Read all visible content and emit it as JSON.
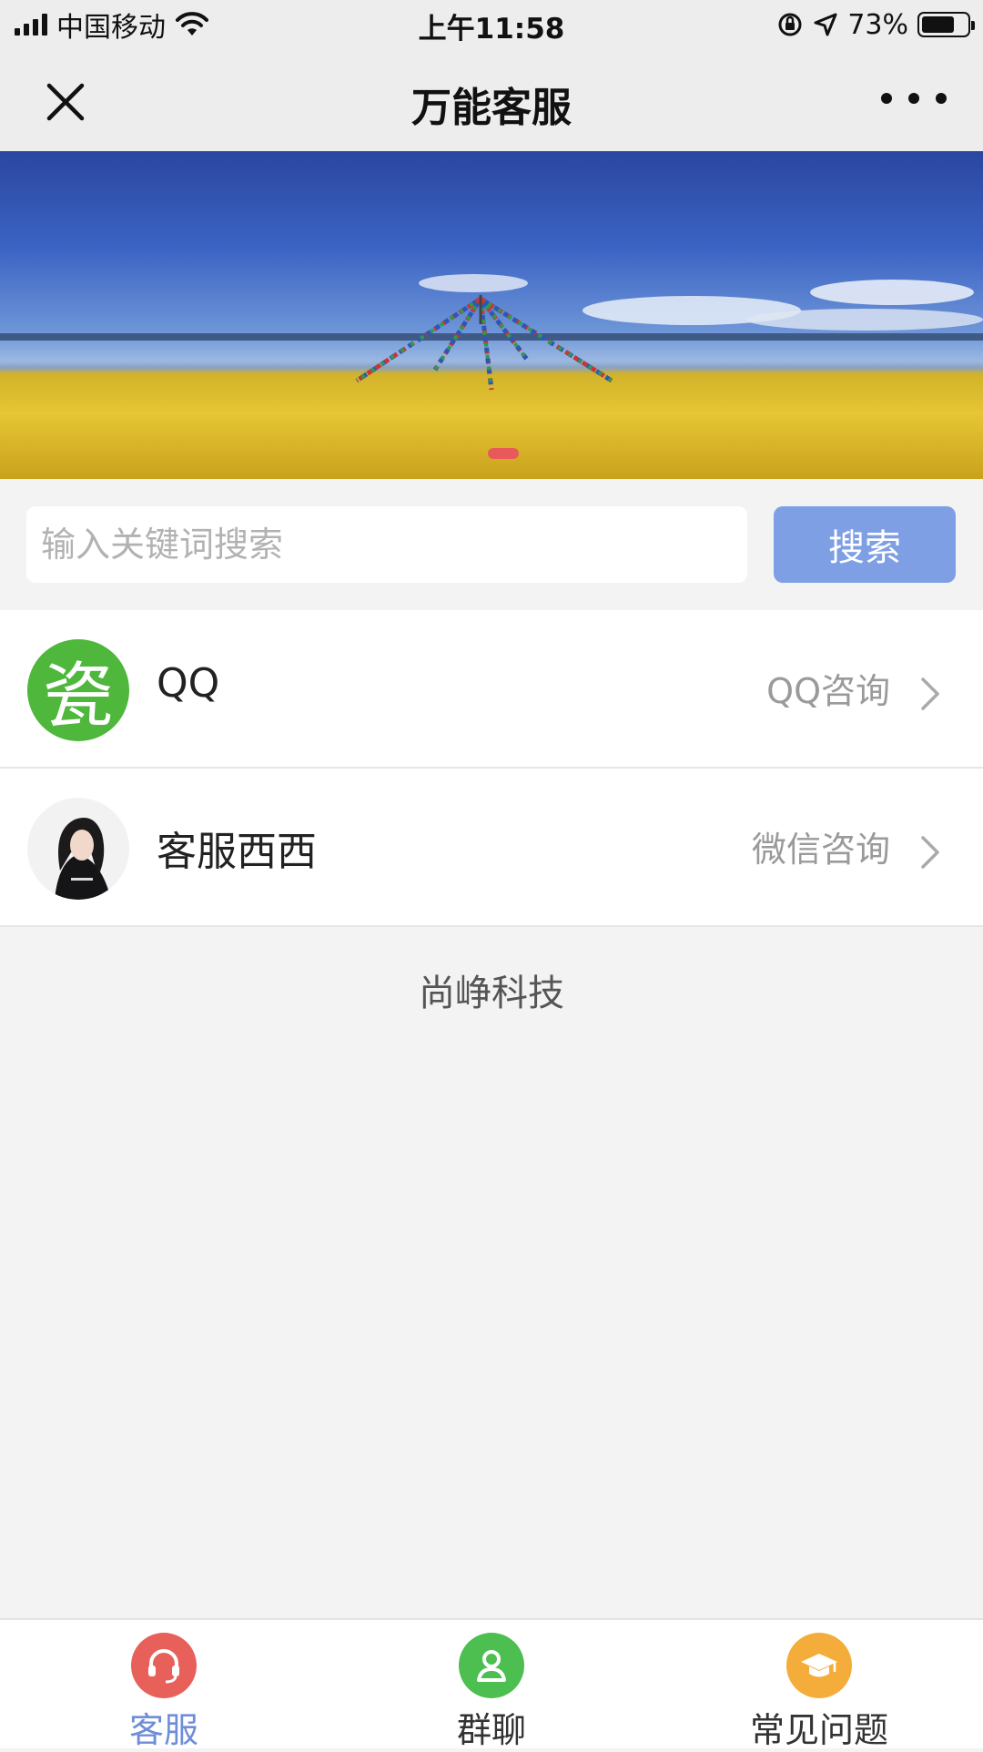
{
  "status_bar": {
    "carrier": "中国移动",
    "time": "上午11:58",
    "battery_percent_label": "73%",
    "battery_level": 0.73,
    "signal_bars": 4
  },
  "nav": {
    "title": "万能客服"
  },
  "banner": {
    "slide_count": 1,
    "active_slide": 1
  },
  "search": {
    "placeholder": "输入关键词搜索",
    "value": "",
    "button_label": "搜索",
    "button_color": "#7f9fe4"
  },
  "contacts": [
    {
      "name": "QQ",
      "action": "QQ咨询",
      "avatar_glyph": "瓷",
      "avatar_color": "#4eb73c"
    },
    {
      "name": "客服西西",
      "action": "微信咨询",
      "avatar_glyph": "",
      "avatar_color": ""
    }
  ],
  "footer_text": "尚峥科技",
  "tabs": [
    {
      "label": "客服",
      "icon": "headset-icon",
      "color": "#e8605a",
      "active": true
    },
    {
      "label": "群聊",
      "icon": "users-icon",
      "color": "#4cbf50",
      "active": false
    },
    {
      "label": "常见问题",
      "icon": "graduation-cap-icon",
      "color": "#f4ad3a",
      "active": false
    }
  ],
  "colors": {
    "accent": "#7f9fe4",
    "active_tab_text": "#6f8ed8"
  }
}
